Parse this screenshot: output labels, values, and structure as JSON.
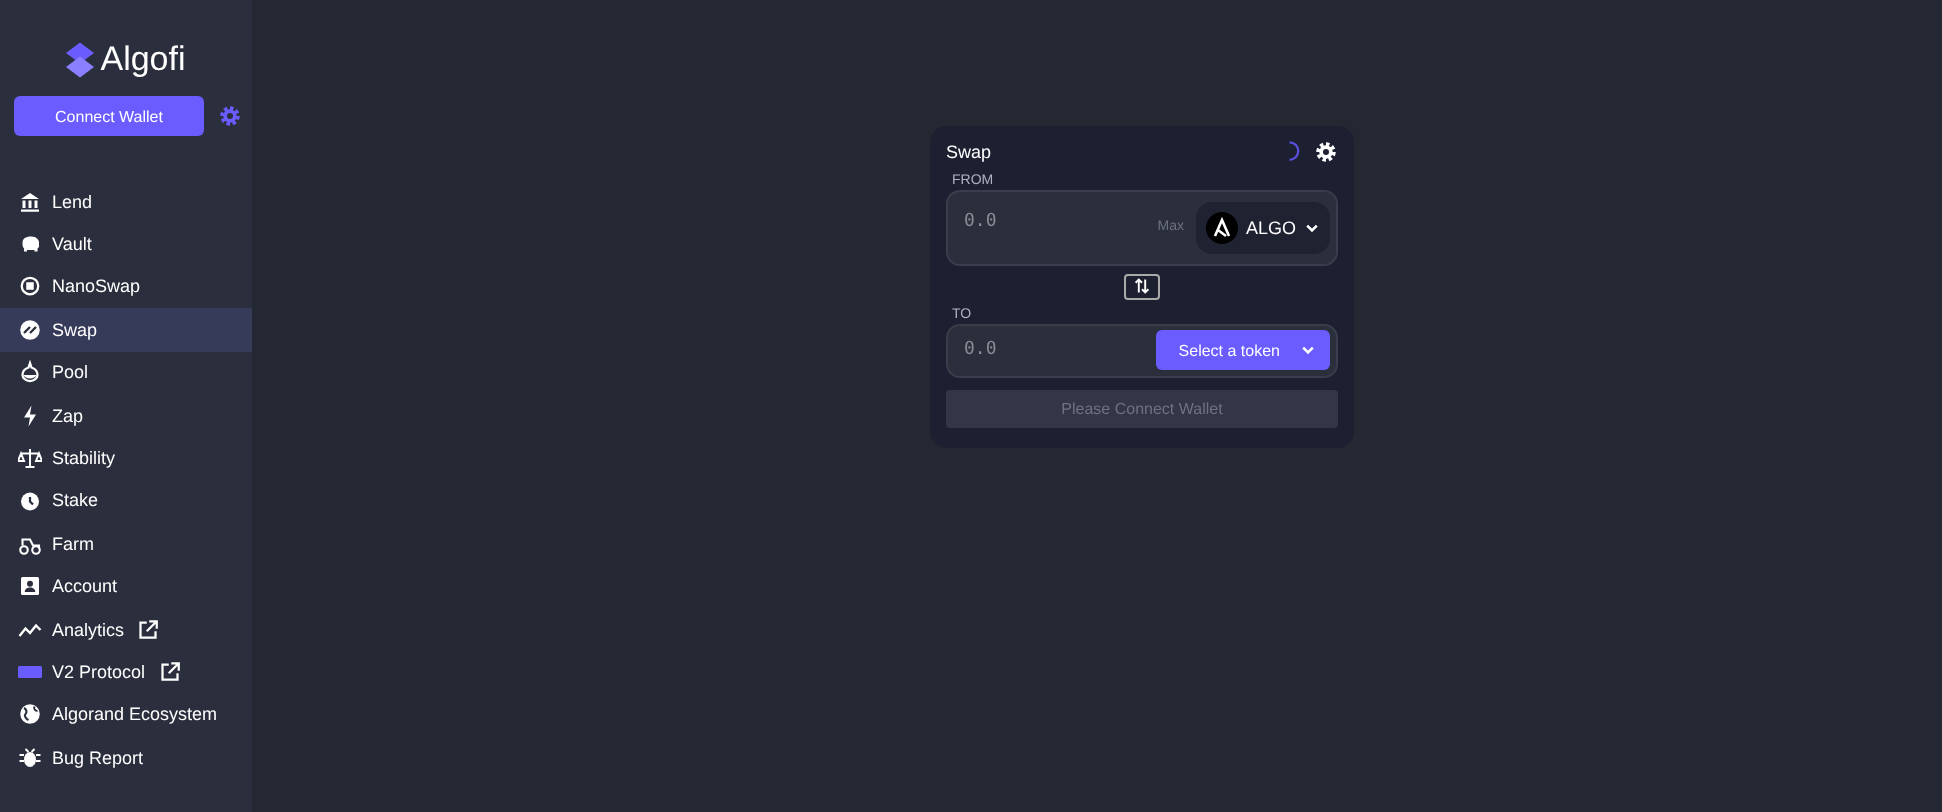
{
  "brand": {
    "name": "Algofi"
  },
  "connect_button": {
    "label": "Connect Wallet"
  },
  "sidebar": {
    "items": [
      {
        "label": "Lend",
        "selected": false,
        "external": false
      },
      {
        "label": "Vault",
        "selected": false,
        "external": false
      },
      {
        "label": "NanoSwap",
        "selected": false,
        "external": false
      },
      {
        "label": "Swap",
        "selected": true,
        "external": false
      },
      {
        "label": "Pool",
        "selected": false,
        "external": false
      },
      {
        "label": "Zap",
        "selected": false,
        "external": false
      },
      {
        "label": "Stability",
        "selected": false,
        "external": false
      },
      {
        "label": "Stake",
        "selected": false,
        "external": false
      },
      {
        "label": "Farm",
        "selected": false,
        "external": false
      },
      {
        "label": "Account",
        "selected": false,
        "external": false
      },
      {
        "label": "Analytics",
        "selected": false,
        "external": true
      },
      {
        "label": "V2 Protocol",
        "selected": false,
        "external": true
      },
      {
        "label": "Algorand Ecosystem",
        "selected": false,
        "external": false
      },
      {
        "label": "Bug Report",
        "selected": false,
        "external": false
      }
    ]
  },
  "swap": {
    "title": "Swap",
    "loading": true,
    "from": {
      "label": "FROM",
      "placeholder": "0.0",
      "max": "Max",
      "token": "ALGO"
    },
    "to": {
      "label": "TO",
      "placeholder": "0.0",
      "token_button": "Select a token"
    },
    "submit": {
      "label": "Please Connect Wallet",
      "disabled": true
    }
  }
}
